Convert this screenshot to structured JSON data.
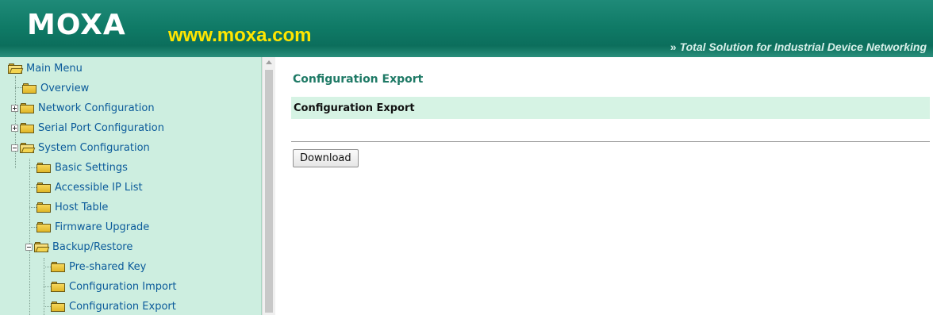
{
  "header": {
    "logo_text": "MOXA",
    "logo_url": "www.moxa.com",
    "tagline": "Total Solution for Industrial Device Networking",
    "tagline_chevron": "»",
    "brand_color": "#0f7a66",
    "url_color": "#ffe600"
  },
  "sidebar": {
    "items": [
      {
        "label": "Main Menu",
        "icon": "folder-open-icon"
      },
      {
        "label": "Overview",
        "icon": "folder-icon"
      },
      {
        "label": "Network Configuration",
        "icon": "folder-icon",
        "toggle": "plus"
      },
      {
        "label": "Serial Port Configuration",
        "icon": "folder-icon",
        "toggle": "plus"
      },
      {
        "label": "System Configuration",
        "icon": "folder-open-icon",
        "toggle": "minus"
      },
      {
        "label": "Basic Settings",
        "icon": "folder-icon"
      },
      {
        "label": "Accessible IP List",
        "icon": "folder-icon"
      },
      {
        "label": "Host Table",
        "icon": "folder-icon"
      },
      {
        "label": "Firmware Upgrade",
        "icon": "folder-icon"
      },
      {
        "label": "Backup/Restore",
        "icon": "folder-open-icon",
        "toggle": "minus"
      },
      {
        "label": "Pre-shared Key",
        "icon": "folder-icon"
      },
      {
        "label": "Configuration Import",
        "icon": "folder-icon"
      },
      {
        "label": "Configuration Export",
        "icon": "folder-icon"
      }
    ]
  },
  "main": {
    "page_title": "Configuration Export",
    "section_title": "Configuration Export",
    "download_label": "Download"
  }
}
